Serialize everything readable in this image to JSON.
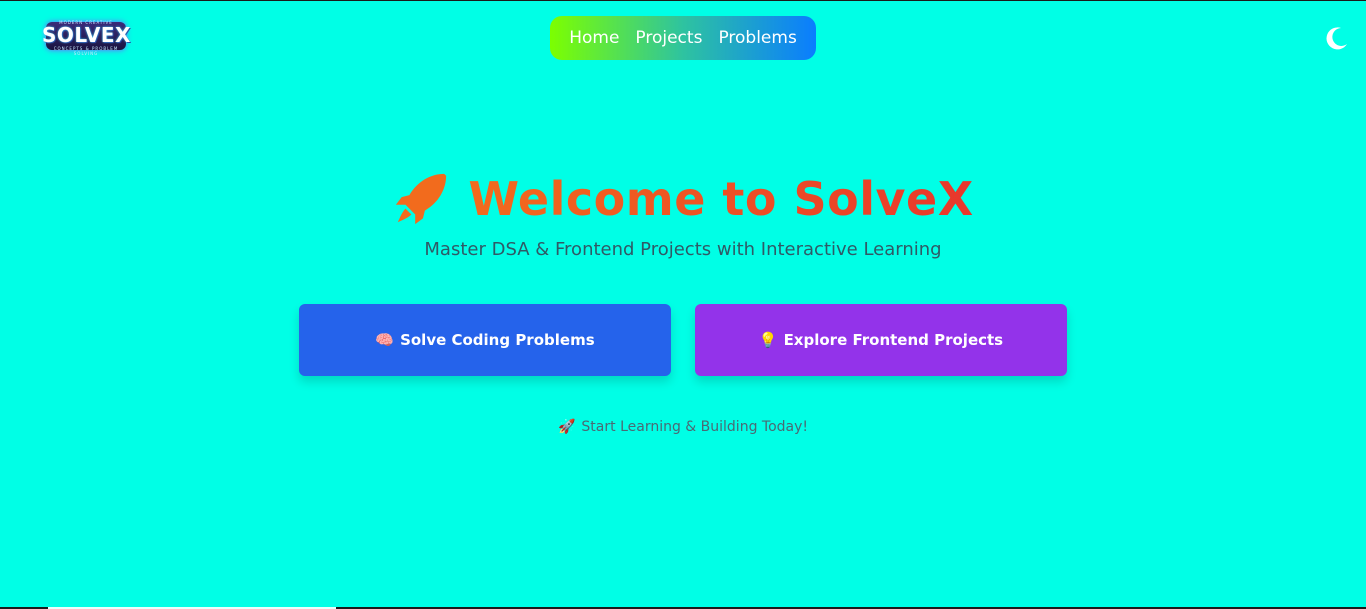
{
  "header": {
    "logo": {
      "text": "SOLVEX",
      "top_tagline": "MODERN CREATIVE",
      "bottom_tagline": "CONCEPTS & PROBLEM SOLVING"
    },
    "nav": {
      "items": [
        {
          "label": "Home"
        },
        {
          "label": "Projects"
        },
        {
          "label": "Problems"
        }
      ],
      "gradient": [
        "#7cff00",
        "#0a7dff"
      ]
    },
    "theme_toggle_icon": "moon-icon"
  },
  "hero": {
    "icon": "rocket-icon",
    "title": "Welcome to SolveX",
    "subtitle": "Master DSA & Frontend Projects with Interactive Learning",
    "buttons": [
      {
        "emoji": "🧠",
        "label": "Solve Coding Problems",
        "color": "#2563eb"
      },
      {
        "emoji": "💡",
        "label": "Explore Frontend Projects",
        "color": "#9333ea"
      }
    ],
    "tagline_emoji": "🚀",
    "tagline": "Start Learning & Building Today!"
  },
  "colors": {
    "background": "#00ffe6",
    "title_gradient": [
      "#f26b1d",
      "#e8372c"
    ]
  }
}
